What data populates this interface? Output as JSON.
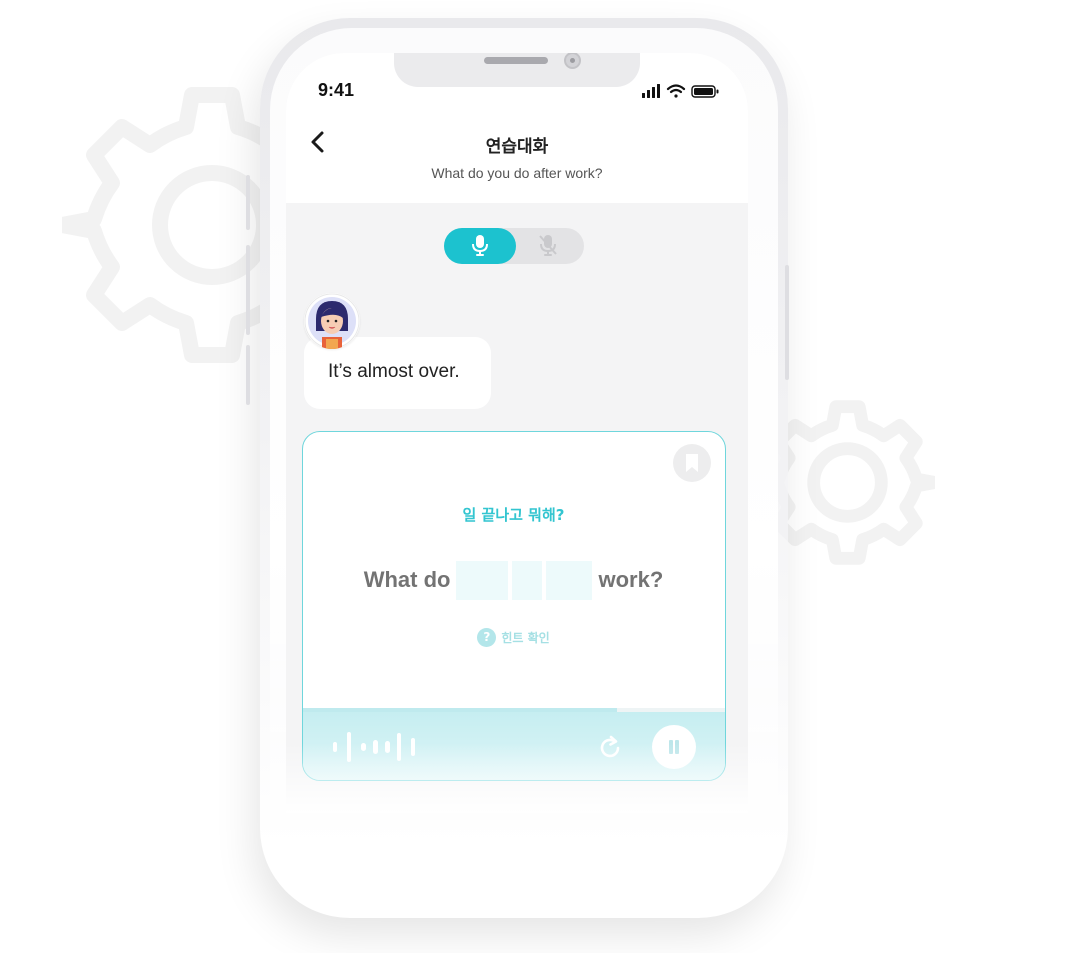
{
  "status_bar": {
    "time": "9:41",
    "icons": [
      "signal-icon",
      "wifi-icon",
      "battery-icon"
    ]
  },
  "header": {
    "back_icon": "chevron-left-icon",
    "title": "연습대화",
    "subtitle": "What do you do after work?"
  },
  "mic_toggle": {
    "selected": "mic-on",
    "options": [
      "microphone-icon",
      "microphone-off-icon"
    ]
  },
  "chat": {
    "avatar": "teacher-avatar",
    "message": "It’s almost over."
  },
  "quiz": {
    "translation": "일 끝나고 뭐해?",
    "sentence_prefix": "What do",
    "sentence_suffix": "work?",
    "blank_count": 3,
    "hint_mark": "?",
    "hint_label": "힌트 확인",
    "bookmark_icon": "bookmark-icon"
  },
  "recorder": {
    "progress": 0.74,
    "waveform_icon": "waveform-icon",
    "retry_icon": "retry-icon",
    "pause_icon": "pause-icon"
  },
  "colors": {
    "accent": "#1cc2cf",
    "accent_light": "#c6eef1",
    "card_border": "#6fd6dc"
  }
}
